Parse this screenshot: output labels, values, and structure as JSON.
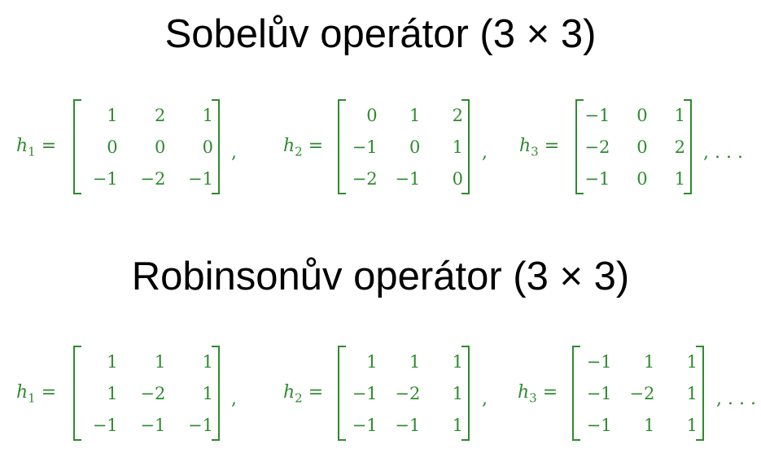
{
  "title_sobel": "Sobelův operátor (3 × 3)",
  "title_robinson": "Robinsonův operátor (3 × 3)",
  "sobel": {
    "h1": {
      "label": "h",
      "sub": "1",
      "eq": "=",
      "rows": [
        [
          "1",
          "2",
          "1"
        ],
        [
          "0",
          "0",
          "0"
        ],
        [
          "−1",
          "−2",
          "−1"
        ]
      ],
      "trail": ","
    },
    "h2": {
      "label": "h",
      "sub": "2",
      "eq": "=",
      "rows": [
        [
          "0",
          "1",
          "2"
        ],
        [
          "−1",
          "0",
          "1"
        ],
        [
          "−2",
          "−1",
          "0"
        ]
      ],
      "trail": ","
    },
    "h3": {
      "label": "h",
      "sub": "3",
      "eq": "=",
      "rows": [
        [
          "−1",
          "0",
          "1"
        ],
        [
          "−2",
          "0",
          "2"
        ],
        [
          "−1",
          "0",
          "1"
        ]
      ],
      "trail": ", . . ."
    }
  },
  "robinson": {
    "h1": {
      "label": "h",
      "sub": "1",
      "eq": "=",
      "rows": [
        [
          "1",
          "1",
          "1"
        ],
        [
          "1",
          "−2",
          "1"
        ],
        [
          "−1",
          "−1",
          "−1"
        ]
      ],
      "trail": ","
    },
    "h2": {
      "label": "h",
      "sub": "2",
      "eq": "=",
      "rows": [
        [
          "1",
          "1",
          "1"
        ],
        [
          "−1",
          "−2",
          "1"
        ],
        [
          "−1",
          "−1",
          "1"
        ]
      ],
      "trail": ","
    },
    "h3": {
      "label": "h",
      "sub": "3",
      "eq": "=",
      "rows": [
        [
          "−1",
          "1",
          "1"
        ],
        [
          "−1",
          "−2",
          "1"
        ],
        [
          "−1",
          "1",
          "1"
        ]
      ],
      "trail": ", . . ."
    }
  },
  "colors": {
    "math": "#2e8b2e",
    "title": "#000000"
  }
}
